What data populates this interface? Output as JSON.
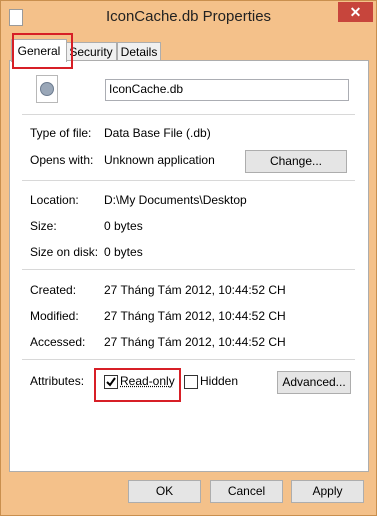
{
  "window": {
    "title": "IconCache.db Properties",
    "close_glyph": "✕"
  },
  "tabs": [
    {
      "label": "General"
    },
    {
      "label": "Security"
    },
    {
      "label": "Details"
    }
  ],
  "file": {
    "name": "IconCache.db"
  },
  "details": {
    "type_label": "Type of file:",
    "type_value": "Data Base File (.db)",
    "opens_label": "Opens with:",
    "opens_value": "Unknown application",
    "change_button": "Change...",
    "location_label": "Location:",
    "location_value": "D:\\My Documents\\Desktop",
    "size_label": "Size:",
    "size_value": "0 bytes",
    "size_on_disk_label": "Size on disk:",
    "size_on_disk_value": "0 bytes",
    "created_label": "Created:",
    "created_value": "27 Tháng Tám 2012, 10:44:52 CH",
    "modified_label": "Modified:",
    "modified_value": "27 Tháng Tám 2012, 10:44:52 CH",
    "accessed_label": "Accessed:",
    "accessed_value": "27 Tháng Tám 2012, 10:44:52 CH",
    "attributes_label": "Attributes:",
    "readonly_label": "Read-only",
    "readonly_checked": true,
    "hidden_label": "Hidden",
    "hidden_checked": false,
    "advanced_button": "Advanced..."
  },
  "footer": {
    "ok": "OK",
    "cancel": "Cancel",
    "apply": "Apply"
  },
  "colors": {
    "frame": "#f4c18a",
    "close": "#c7453c",
    "highlight": "#d71f26"
  },
  "icons": {
    "app": "file-icon",
    "file": "gear-document-icon"
  }
}
